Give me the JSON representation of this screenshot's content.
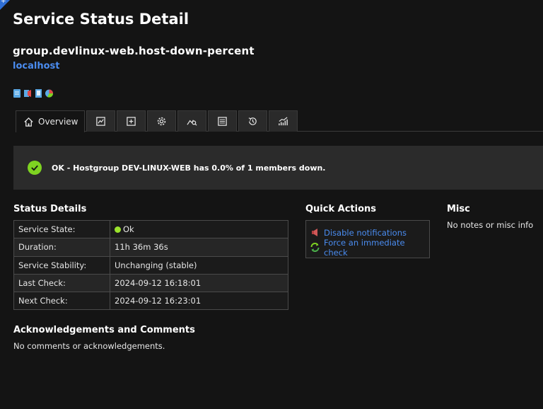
{
  "page": {
    "title": "Service Status Detail",
    "service_name": "group.devlinux-web.host-down-percent",
    "host": "localhost"
  },
  "status_icons": [
    "notes-icon",
    "notifications-icon",
    "document-icon",
    "chart-icon"
  ],
  "tabs": [
    {
      "label": "Overview",
      "icon": "home-icon"
    },
    {
      "label": "",
      "icon": "chart-icon"
    },
    {
      "label": "",
      "icon": "plus-box-icon"
    },
    {
      "label": "",
      "icon": "gear-icon"
    },
    {
      "label": "",
      "icon": "graph-search-icon"
    },
    {
      "label": "",
      "icon": "list-icon"
    },
    {
      "label": "",
      "icon": "history-icon"
    },
    {
      "label": "",
      "icon": "trend-icon"
    }
  ],
  "banner": {
    "text": "OK - Hostgroup DEV-LINUX-WEB has 0.0% of 1 members down.",
    "color": "#7ed321"
  },
  "status_details": {
    "title": "Status Details",
    "rows": [
      {
        "label": "Service State:",
        "value": "Ok"
      },
      {
        "label": "Duration:",
        "value": "11h 36m 36s"
      },
      {
        "label": "Service Stability:",
        "value": "Unchanging (stable)"
      },
      {
        "label": "Last Check:",
        "value": "2024-09-12 16:18:01"
      },
      {
        "label": "Next Check:",
        "value": "2024-09-12 16:23:01"
      }
    ]
  },
  "quick_actions": {
    "title": "Quick Actions",
    "items": [
      {
        "label": "Disable notifications",
        "icon": "megaphone-icon"
      },
      {
        "label": "Force an immediate check",
        "icon": "refresh-icon"
      }
    ]
  },
  "misc": {
    "title": "Misc",
    "text": "No notes or misc info"
  },
  "acknowledgements": {
    "title": "Acknowledgements and Comments",
    "text": "No comments or acknowledgements."
  },
  "colors": {
    "background": "#141414",
    "link": "#4a8cf0",
    "ok_green": "#7ed321"
  }
}
